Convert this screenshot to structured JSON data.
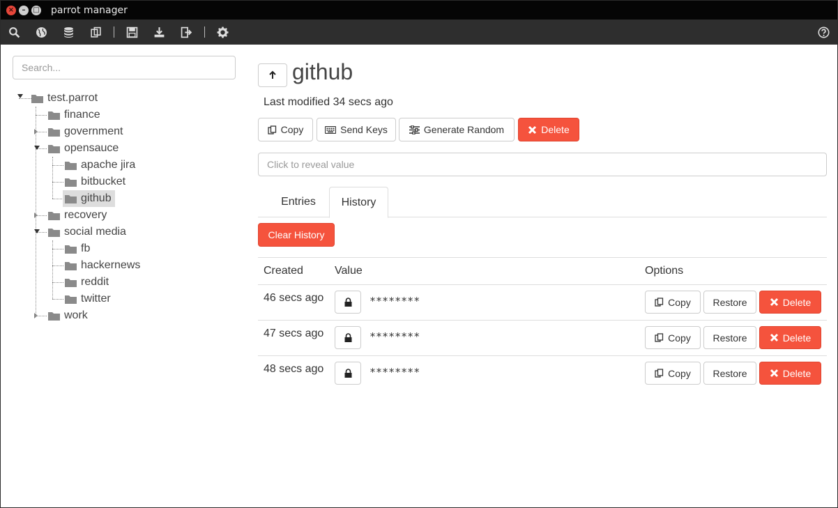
{
  "window": {
    "title": "parrot manager"
  },
  "sidebar": {
    "search_placeholder": "Search...",
    "tree": {
      "root": "test.parrot",
      "finance": "finance",
      "government": "government",
      "opensauce": "opensauce",
      "apache_jira": "apache jira",
      "bitbucket": "bitbucket",
      "github": "github",
      "recovery": "recovery",
      "social_media": "social media",
      "fb": "fb",
      "hackernews": "hackernews",
      "reddit": "reddit",
      "twitter": "twitter",
      "work": "work"
    }
  },
  "entry": {
    "title": "github",
    "last_modified": "Last modified 34 secs ago",
    "copy_label": "Copy",
    "send_keys_label": "Send Keys",
    "generate_random_label": "Generate Random",
    "delete_label": "Delete",
    "reveal_placeholder": "Click to reveal value"
  },
  "tabs": {
    "entries": "Entries",
    "history": "History",
    "active": "History"
  },
  "history": {
    "clear_label": "Clear History",
    "headers": {
      "created": "Created",
      "value": "Value",
      "options": "Options"
    },
    "rows": [
      {
        "created": "46 secs ago",
        "value": "********",
        "copy": "Copy",
        "restore": "Restore",
        "delete": "Delete"
      },
      {
        "created": "47 secs ago",
        "value": "********",
        "copy": "Copy",
        "restore": "Restore",
        "delete": "Delete"
      },
      {
        "created": "48 secs ago",
        "value": "********",
        "copy": "Copy",
        "restore": "Restore",
        "delete": "Delete"
      }
    ]
  },
  "colors": {
    "danger": "#f5533d",
    "toolbar": "#2e2e2e",
    "titlebar": "#050505",
    "selected": "#dddddd"
  }
}
